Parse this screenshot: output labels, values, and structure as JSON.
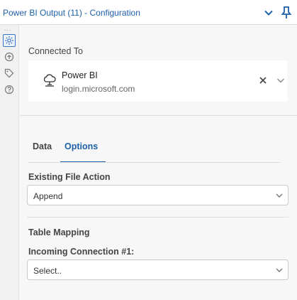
{
  "header": {
    "title": "Power BI Output (11) - Configuration",
    "collapse_icon": "chevron-down-icon",
    "pin_icon": "pin-icon"
  },
  "rail": {
    "overflow": "...",
    "icons": [
      "gear-icon",
      "connections-icon",
      "tag-icon",
      "help-icon"
    ],
    "active": "gear-icon"
  },
  "connection": {
    "label": "Connected To",
    "service": "Power BI",
    "account": "login.microsoft.com"
  },
  "tabs": [
    {
      "label": "Data",
      "active": false
    },
    {
      "label": "Options",
      "active": true
    }
  ],
  "options": {
    "existing_file_action": {
      "label": "Existing File Action",
      "value": "Append"
    },
    "table_mapping": {
      "label": "Table Mapping"
    },
    "incoming_connection": {
      "label": "Incoming Connection #1:",
      "placeholder": "Select.."
    }
  },
  "colors": {
    "accent": "#1e5fa8",
    "background": "#f7f7f8"
  }
}
